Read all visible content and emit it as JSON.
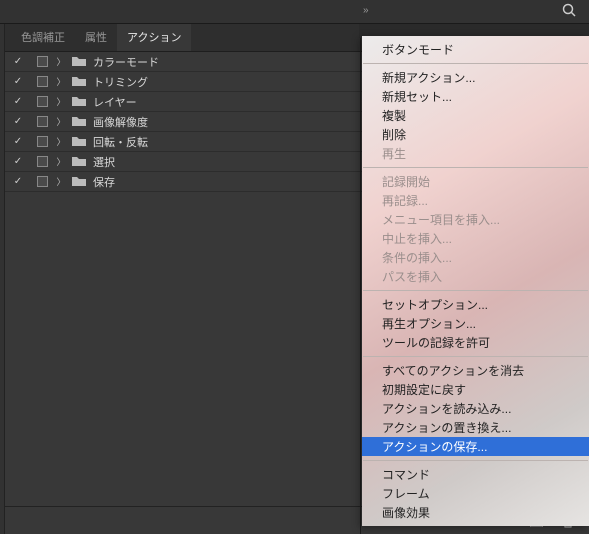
{
  "tabs": {
    "color": "色調補正",
    "attr": "属性",
    "action": "アクション"
  },
  "rows": [
    {
      "label": "カラーモード"
    },
    {
      "label": "トリミング"
    },
    {
      "label": "レイヤー"
    },
    {
      "label": "画像解像度"
    },
    {
      "label": "回転・反転"
    },
    {
      "label": "選択"
    },
    {
      "label": "保存"
    }
  ],
  "menu": {
    "buttonMode": "ボタンモード",
    "newAction": "新規アクション...",
    "newSet": "新規セット...",
    "duplicate": "複製",
    "delete": "削除",
    "play": "再生",
    "startRec": "記録開始",
    "reRecord": "再記録...",
    "insertMenu": "メニュー項目を挿入...",
    "insertStop": "中止を挿入...",
    "insertCond": "条件の挿入...",
    "insertPath": "パスを挿入",
    "setOptions": "セットオプション...",
    "playOptions": "再生オプション...",
    "allowTool": "ツールの記録を許可",
    "clearAll": "すべてのアクションを消去",
    "resetDefault": "初期設定に戻す",
    "loadActions": "アクションを読み込み...",
    "replaceActions": "アクションの置き換え...",
    "saveActions": "アクションの保存...",
    "command": "コマンド",
    "frame": "フレーム",
    "imageFx": "画像効果"
  }
}
